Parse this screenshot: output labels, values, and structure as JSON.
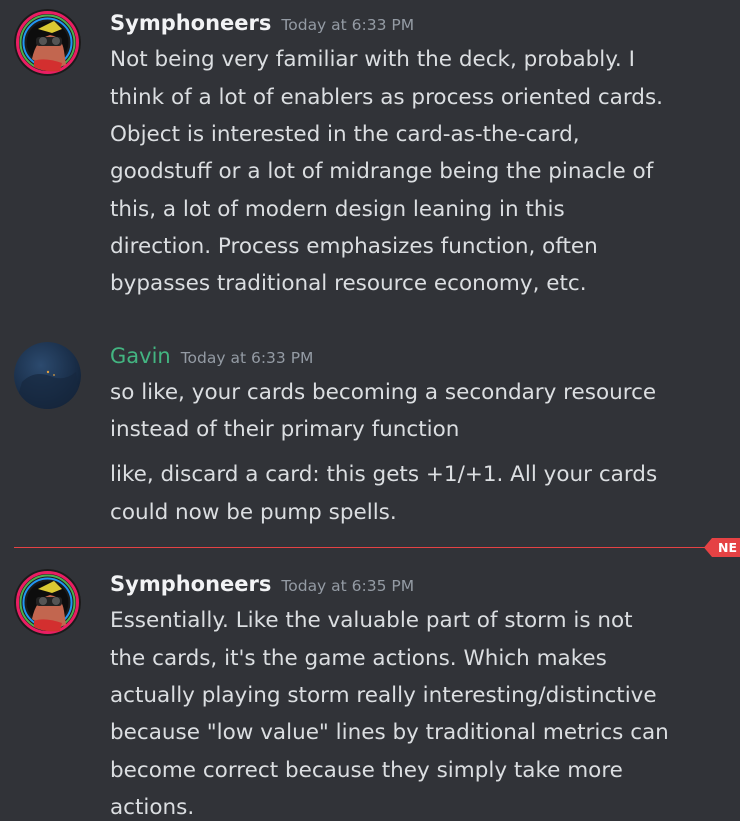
{
  "colors": {
    "background": "#313338",
    "text": "#dbdee1",
    "timestamp": "#949ba4",
    "symphoneers_name": "#f2f3f5",
    "gavin_name": "#43b581",
    "new_divider": "#e54244"
  },
  "messages": [
    {
      "author": "Symphoneers",
      "timestamp": "Today at 6:33 PM",
      "avatar_icon": "masked-face-avatar-icon",
      "lines": [
        "Not being very familiar with the deck, probably. I",
        "think of a lot of enablers as process oriented cards.",
        "Object is interested in the card-as-the-card,",
        "goodstuff or a lot of midrange being the pinacle of",
        "this, a lot of modern design leaning in this",
        "direction. Process emphasizes function, often",
        "bypasses traditional resource economy, etc."
      ]
    },
    {
      "author": "Gavin",
      "timestamp": "Today at 6:33 PM",
      "avatar_icon": "dark-blue-space-avatar-icon",
      "lines": [
        "so like, your cards becoming a secondary resource",
        "instead of their primary function"
      ],
      "followup_lines": [
        "like, discard a card: this gets +1/+1. All your cards",
        "could now be pump spells."
      ]
    },
    {
      "author": "Symphoneers",
      "timestamp": "Today at 6:35 PM",
      "avatar_icon": "masked-face-avatar-icon",
      "lines": [
        "Essentially. Like the valuable part of storm is not",
        "the cards, it's the game actions. Which makes",
        "actually playing storm really interesting/distinctive",
        "because \"low value\" lines by traditional metrics can",
        "become correct because they simply take more",
        "actions."
      ]
    }
  ],
  "new_divider": {
    "label": "NE"
  }
}
